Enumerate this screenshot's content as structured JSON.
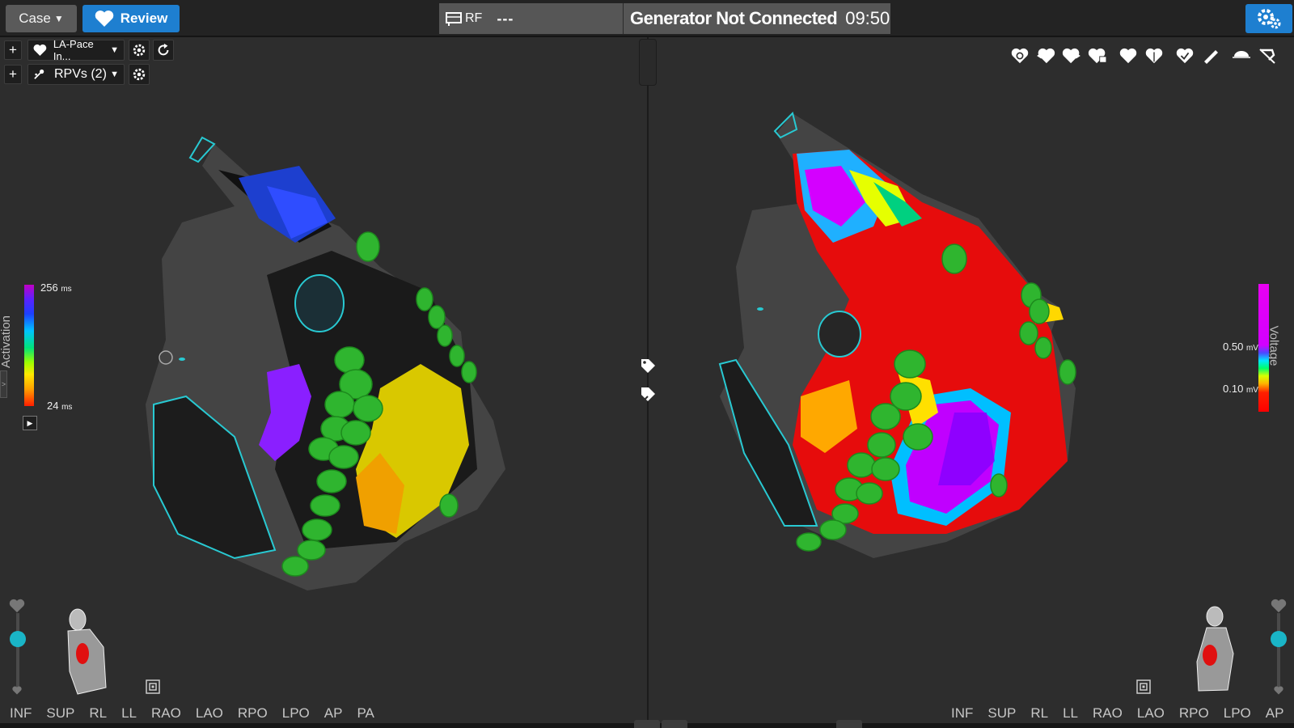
{
  "topbar": {
    "case_label": "Case",
    "review_label": "Review",
    "rf_label": "RF",
    "rf_value": "---",
    "generator_status": "Generator Not Connected",
    "clock": "09:50"
  },
  "left_view": {
    "map_selector": "LA-Pace In...",
    "tag_selector": "RPVs (2)",
    "legend": {
      "title": "Activation",
      "max_value": "256",
      "min_value": "24",
      "unit": "ms"
    }
  },
  "right_view": {
    "legend": {
      "title": "Voltage",
      "high_value": "0.50",
      "low_value": "0.10",
      "unit": "mV"
    }
  },
  "view_buttons": [
    "INF",
    "SUP",
    "RL",
    "LL",
    "RAO",
    "LAO",
    "RPO",
    "LPO",
    "AP",
    "PA"
  ],
  "colors": {
    "accent_blue": "#1e7fd0",
    "slider_teal": "#1ab5c7",
    "ablation_green": "#2fb52f"
  }
}
